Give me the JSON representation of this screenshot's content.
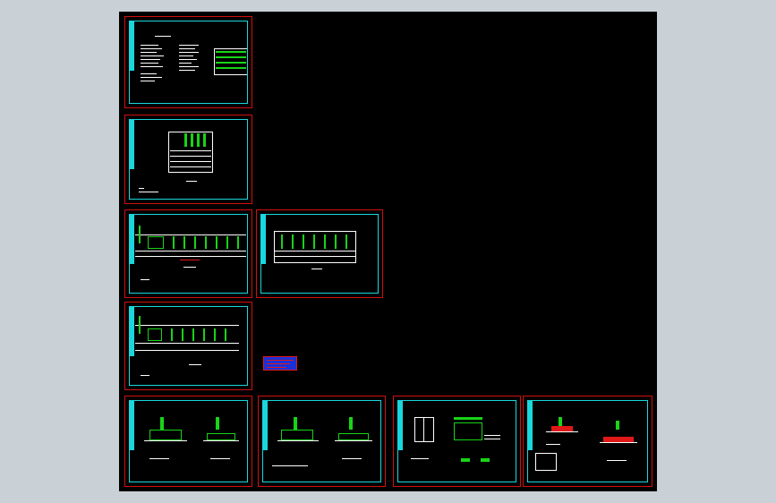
{
  "app": {
    "title": "",
    "background_color": "#c9d0d6",
    "canvas_color": "#000000"
  },
  "colors": {
    "frame_outer": "#d01010",
    "frame_inner": "#19d7dd",
    "linework_green": "#18d418",
    "linework_white": "#ffffff",
    "annotation_red": "#e01818",
    "legend_block": "#1a30d8"
  },
  "sheets": [
    {
      "id": "sheet-1",
      "caption": ""
    },
    {
      "id": "sheet-2",
      "caption": ""
    },
    {
      "id": "sheet-3",
      "caption": ""
    },
    {
      "id": "sheet-4",
      "caption": ""
    },
    {
      "id": "sheet-5",
      "caption": ""
    },
    {
      "id": "sheet-6",
      "caption": ""
    },
    {
      "id": "sheet-7",
      "caption": ""
    },
    {
      "id": "sheet-8",
      "caption": ""
    },
    {
      "id": "sheet-9",
      "caption": ""
    }
  ]
}
